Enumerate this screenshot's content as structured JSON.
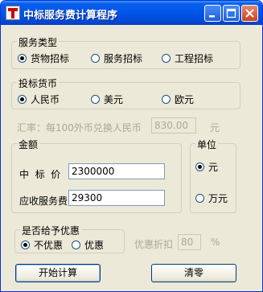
{
  "window": {
    "title": "中标服务费计算程序",
    "accent": "#0058ee"
  },
  "bid_type": {
    "legend": "服务类型",
    "options": [
      "货物招标",
      "服务招标",
      "工程招标"
    ],
    "selected": "货物招标"
  },
  "currency": {
    "legend": "投标货币",
    "options": [
      "人民币",
      "美元",
      "欧元"
    ],
    "selected": "人民币"
  },
  "rate": {
    "label": "汇率：每100外币兑换人民币",
    "value": "830.00",
    "unit": "元"
  },
  "amount": {
    "legend": "金额",
    "bid_price_label": "中  标  价",
    "bid_price_value": "2300000",
    "fee_label": "应收服务费",
    "fee_value": "29300"
  },
  "unit": {
    "legend": "单位",
    "options": [
      "元",
      "万元"
    ],
    "selected": "元"
  },
  "discount": {
    "legend": "是否给予优惠",
    "options": [
      "不优惠",
      "优惠"
    ],
    "selected": "不优惠",
    "rate_label": "优惠折扣",
    "rate_value": "80",
    "rate_unit": "%"
  },
  "buttons": {
    "calculate": "开始计算",
    "clear": "清零"
  }
}
